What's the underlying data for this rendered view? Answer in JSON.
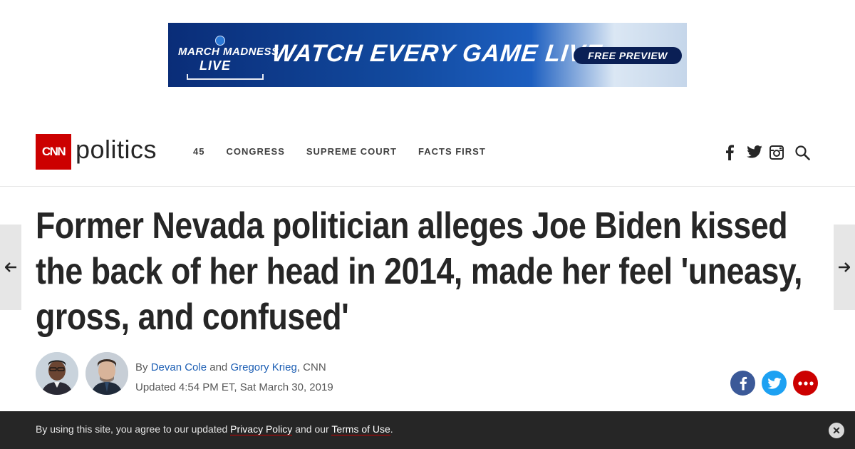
{
  "ad": {
    "brand_line1": "MARCH MADNESS",
    "brand_line2": "LIVE",
    "headline": "WATCH EVERY GAME LIVE",
    "cta": "FREE PREVIEW"
  },
  "header": {
    "logo_box": "CNN",
    "logo_section": "politics",
    "nav": [
      "45",
      "CONGRESS",
      "SUPREME COURT",
      "FACTS FIRST"
    ],
    "social_icons": [
      "facebook-icon",
      "twitter-icon",
      "instagram-icon",
      "search-icon"
    ]
  },
  "article": {
    "title": "Former Nevada politician alleges Joe Biden kissed the back of her head in 2014, made her feel 'uneasy, gross, and confused'",
    "byline_prefix": "By",
    "author1": "Devan Cole",
    "byline_and": "and",
    "author2": "Gregory Krieg",
    "byline_suffix": ", CNN",
    "updated": "Updated 4:54 PM ET, Sat March 30, 2019"
  },
  "share": {
    "buttons": [
      "facebook-share",
      "twitter-share",
      "more-share"
    ],
    "colors": {
      "facebook": "#3b5998",
      "twitter": "#1da1f2",
      "more": "#cc0000"
    }
  },
  "cookie": {
    "text_before": "By using this site, you agree to our updated",
    "privacy_link": "Privacy Policy",
    "text_mid": "and our",
    "terms_link": "Terms of Use",
    "text_end": ".",
    "close": "✕"
  },
  "colors": {
    "brand_red": "#cc0000",
    "text": "#262626",
    "link": "#1d5fb4",
    "cookie_bg": "#262626"
  }
}
